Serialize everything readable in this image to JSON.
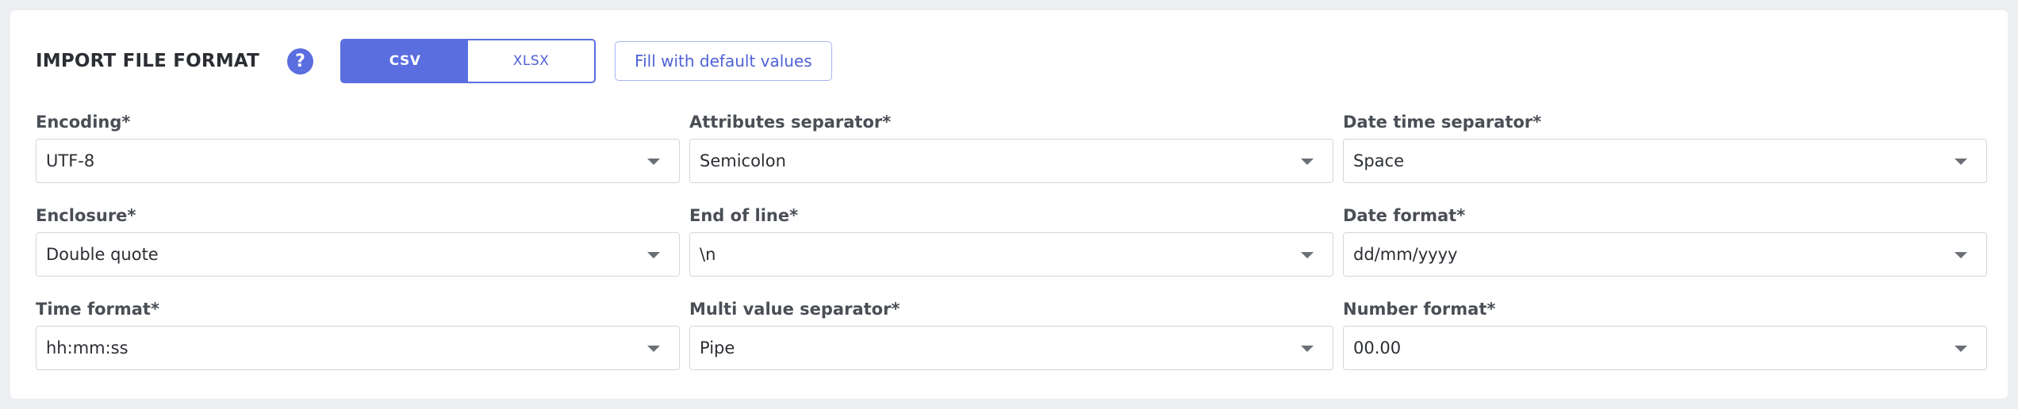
{
  "header": {
    "title": "IMPORT FILE FORMAT",
    "help_glyph": "?",
    "format_tabs": [
      {
        "label": "CSV",
        "active": true
      },
      {
        "label": "XLSX",
        "active": false
      }
    ],
    "default_button_label": "Fill with default values"
  },
  "colors": {
    "accent": "#5a6ee0",
    "panel_bg": "#ffffff",
    "page_bg": "#eceef1"
  },
  "fields": [
    {
      "label": "Encoding*",
      "value": "UTF-8"
    },
    {
      "label": "Attributes separator*",
      "value": "Semicolon"
    },
    {
      "label": "Date time separator*",
      "value": "Space"
    },
    {
      "label": "Enclosure*",
      "value": "Double quote"
    },
    {
      "label": "End of line*",
      "value": "\\n"
    },
    {
      "label": "Date format*",
      "value": "dd/mm/yyyy"
    },
    {
      "label": "Time format*",
      "value": "hh:mm:ss"
    },
    {
      "label": "Multi value separator*",
      "value": "Pipe"
    },
    {
      "label": "Number format*",
      "value": "00.00"
    }
  ]
}
